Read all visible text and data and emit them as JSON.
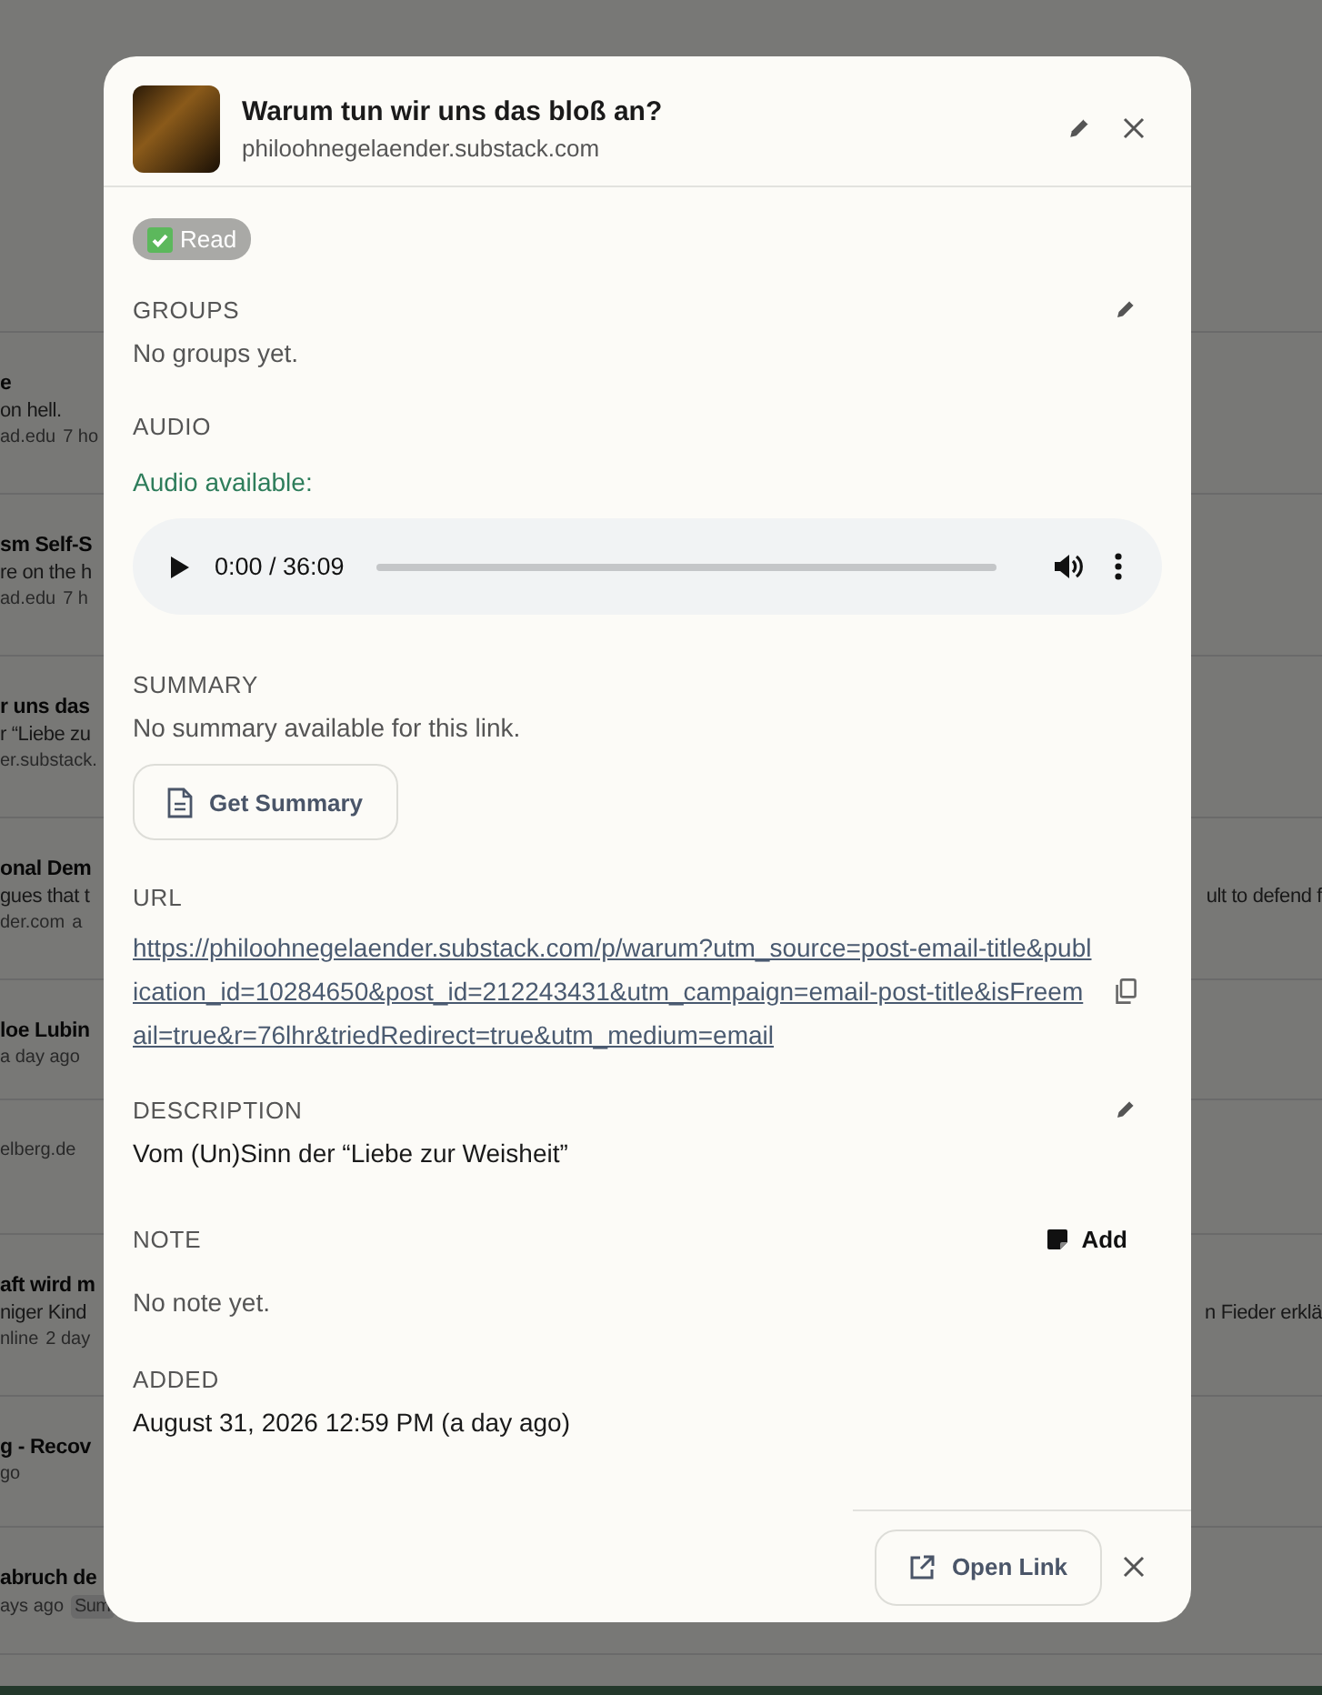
{
  "background_list": {
    "rows": [
      {
        "title": "e",
        "snippet": "on hell.",
        "meta": [
          "ad.edu",
          "7 ho"
        ]
      },
      {
        "title": "sm Self-S",
        "snippet": "re on the h",
        "meta": [
          "ad.edu",
          "7 h"
        ]
      },
      {
        "title": "r uns das",
        "snippet": "r “Liebe zu",
        "meta": [
          "er.substack."
        ]
      },
      {
        "title": "onal Dem",
        "snippet": "gues that t",
        "snippet_right": "ult to defend f",
        "meta": [
          "der.com",
          "a"
        ]
      },
      {
        "title": "loe Lubin",
        "meta": [
          "a day ago"
        ]
      },
      {
        "meta": [
          "elberg.de"
        ]
      },
      {
        "title": "aft wird m",
        "snippet": "niger Kind",
        "snippet_right": "n Fieder erklä",
        "meta": [
          "nline",
          "2 day"
        ]
      },
      {
        "title": "g - Recov",
        "meta": [
          "go"
        ]
      },
      {
        "title": "abruch de",
        "meta": [
          "ays ago"
        ],
        "tag": "Sum"
      }
    ]
  },
  "dialog": {
    "title": "Warum tun wir uns das bloß an?",
    "domain": "philoohnegelaender.substack.com",
    "status_badge": {
      "label": "Read"
    },
    "groups": {
      "label": "GROUPS",
      "text": "No groups yet."
    },
    "audio": {
      "label": "AUDIO",
      "status": "Audio available:",
      "time": "0:00 / 36:09",
      "level": 0
    },
    "summary": {
      "label": "SUMMARY",
      "text": "No summary available for this link.",
      "button": "Get Summary"
    },
    "url": {
      "label": "URL",
      "link": "https://philoohnegelaender.substack.com/p/warum?utm_source=post-email-title&publication_id=10284650&post_id=212243431&utm_campaign=email-post-title&isFreemail=true&r=76lhr&triedRedirect=true&utm_medium=email"
    },
    "description": {
      "label": "DESCRIPTION",
      "text": "Vom (Un)Sinn der “Liebe zur Weisheit”"
    },
    "note": {
      "label": "NOTE",
      "button": "Add",
      "text": "No note yet."
    },
    "added": {
      "label": "ADDED",
      "text": "August 31, 2026 12:59 PM (a day ago)"
    },
    "footer": {
      "button": "Open Link"
    }
  }
}
